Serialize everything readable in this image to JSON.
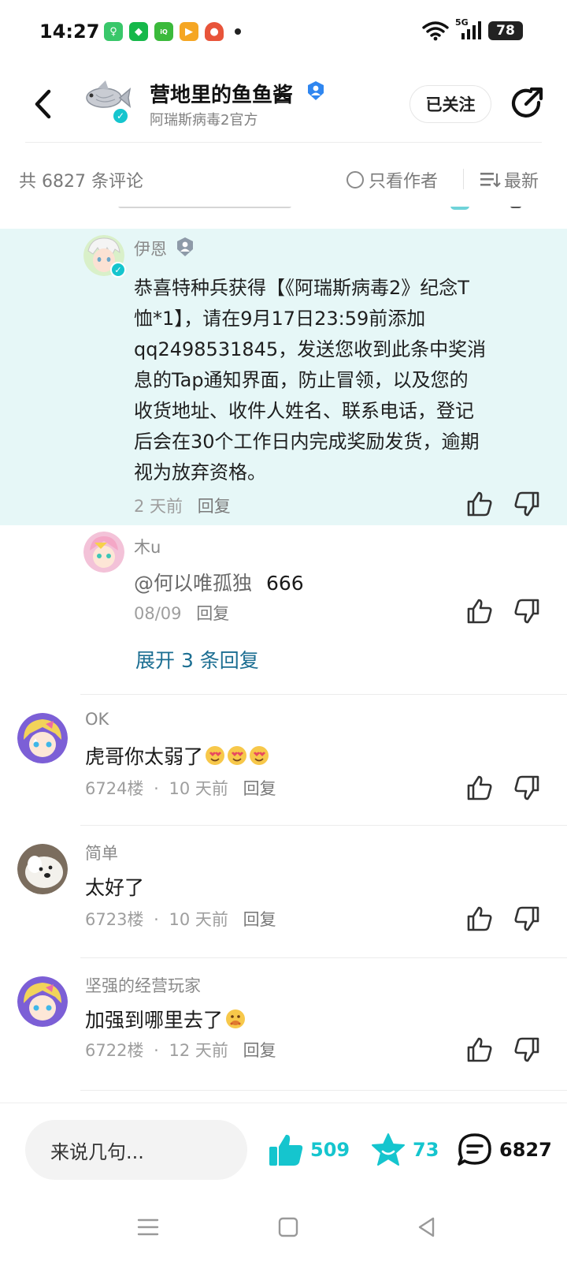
{
  "status_bar": {
    "time": "14:27",
    "network": "5G",
    "battery": "78"
  },
  "header": {
    "author_name": "营地里的鱼鱼酱",
    "author_subtitle": "阿瑞斯病毒2官方",
    "follow_label": "已关注"
  },
  "filter": {
    "count_text": "共 6827 条评论",
    "author_only_label": "只看作者",
    "sort_label": "最新"
  },
  "highlighted_reply": {
    "user": "伊恩",
    "lines": [
      "恭喜特种兵获得【《阿瑞斯病毒2》纪念T",
      "恤*1】，请在9月17日23:59前添加",
      "qq2498531845，发送您收到此条中奖消",
      "息的Tap通知界面，防止冒领，以及您的",
      "收货地址、收件人姓名、联系电话，登记",
      "后会在30个工作日内完成奖励发货，逾期",
      "视为放弃资格。"
    ],
    "time": "2 天前",
    "reply_label": "回复"
  },
  "second_reply": {
    "user": "木u",
    "mention": "@何以唯孤独",
    "text": "666",
    "time": "08/09",
    "reply_label": "回复"
  },
  "expand_label": "展开 3 条回复",
  "comments": [
    {
      "user": "OK",
      "text": "虎哥你太弱了",
      "floor": "6724楼",
      "time": "10 天前",
      "reply_label": "回复"
    },
    {
      "user": "简单",
      "text": "太好了",
      "floor": "6723楼",
      "time": "10 天前",
      "reply_label": "回复"
    },
    {
      "user": "坚强的经营玩家",
      "text": "加强到哪里去了",
      "floor": "6722楼",
      "time": "12 天前",
      "reply_label": "回复"
    }
  ],
  "bottom_bar": {
    "input_placeholder": "来说几句...",
    "likes": "509",
    "favorites": "73",
    "comments": "6827"
  },
  "colors": {
    "accent_teal": "#15c5ce",
    "highlight_bg": "#e6f7f7",
    "link_blue": "#1b6e92"
  }
}
